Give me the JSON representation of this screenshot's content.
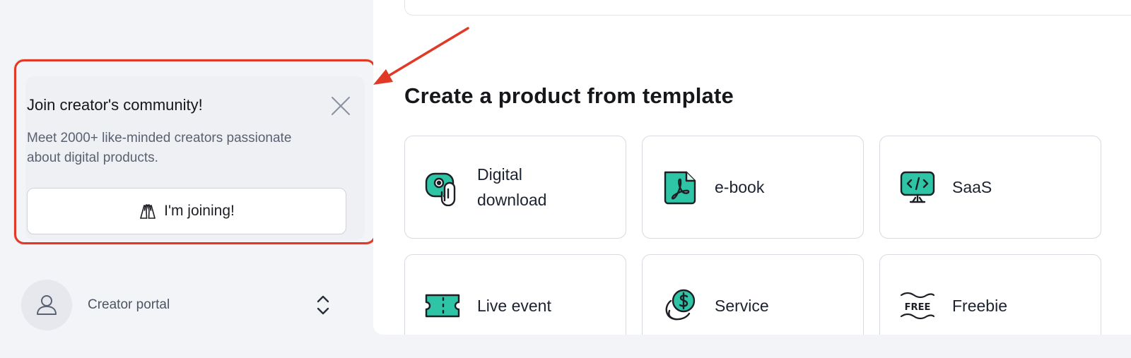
{
  "promo": {
    "title": "Join creator's community!",
    "description": "Meet 2000+ like-minded creators passionate about digital products.",
    "button_label": "I'm joining!",
    "button_icon": "high-five-icon",
    "close_icon": "close-icon"
  },
  "portal": {
    "label": "Creator portal",
    "avatar_icon": "user-icon",
    "switch_icon": "chevron-up-down-icon"
  },
  "main": {
    "section_title": "Create a product from template",
    "templates": [
      {
        "label": "Digital download",
        "icon": "digital-download-icon"
      },
      {
        "label": "e-book",
        "icon": "pdf-icon"
      },
      {
        "label": "SaaS",
        "icon": "code-monitor-icon"
      },
      {
        "label": "Live event",
        "icon": "ticket-icon"
      },
      {
        "label": "Service",
        "icon": "dollar-coin-icon"
      },
      {
        "label": "Freebie",
        "icon": "free-tag-icon"
      }
    ]
  },
  "colors": {
    "accent": "#2ec4a6",
    "highlight": "#e03a27",
    "sidebar_bg": "#f3f4f7",
    "card_border": "#d7dae0"
  }
}
